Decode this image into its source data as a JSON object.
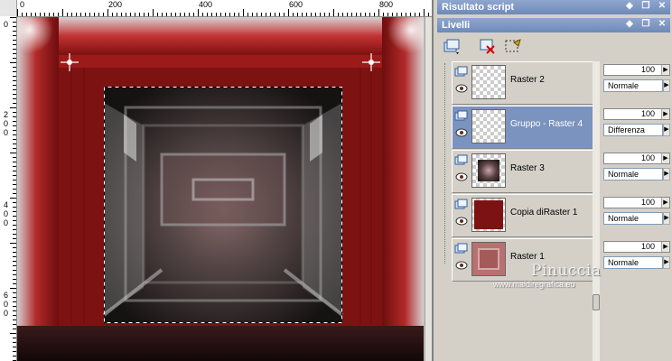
{
  "rulers": {
    "horizontal_labels": [
      "0",
      "200",
      "400",
      "600",
      "800"
    ],
    "vertical_labels": [
      "0",
      "200",
      "400",
      "600"
    ]
  },
  "panels": {
    "script_output": {
      "title": "Risultato script"
    },
    "layers": {
      "title": "Livelli",
      "toolbar_icons": [
        "new-layer-icon",
        "delete-layer-icon",
        "select-layer-icon"
      ],
      "items": [
        {
          "name": "Raster 2",
          "opacity": "100",
          "blend": "Normale",
          "selected": false,
          "thumb": "transparent"
        },
        {
          "name": "Gruppo - Raster 4",
          "opacity": "100",
          "blend": "Differenza",
          "selected": true,
          "thumb": "transparent"
        },
        {
          "name": "Raster 3",
          "opacity": "100",
          "blend": "Normale",
          "selected": false,
          "thumb": "radial"
        },
        {
          "name": "Copia diRaster 1",
          "opacity": "100",
          "blend": "Normale",
          "selected": false,
          "thumb": "darkred"
        },
        {
          "name": "Raster 1",
          "opacity": "100",
          "blend": "Normale",
          "selected": false,
          "thumb": "frame"
        }
      ]
    }
  },
  "watermark": {
    "name": "Pinuccia",
    "url": "www.maidiregrafica.eu"
  },
  "colors": {
    "selected_row": "#7b93bf",
    "panel_title": "#7690bd",
    "frame_red": "#7d1212"
  }
}
